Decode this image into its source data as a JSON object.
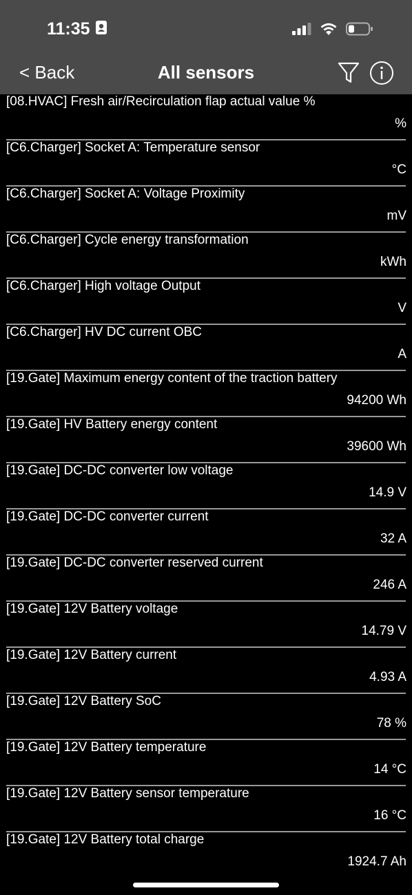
{
  "status_bar": {
    "time": "11:35",
    "icons": [
      "contact-card-icon",
      "signal-icon",
      "wifi-icon",
      "battery-icon"
    ]
  },
  "nav": {
    "back_label": "< Back",
    "title": "All sensors",
    "icons": [
      "filter-icon",
      "info-icon"
    ]
  },
  "sensors": [
    {
      "label": "[08.HVAC] Fresh air/Recirculation flap actual value %",
      "value": "%"
    },
    {
      "label": "[C6.Charger] Socket A: Temperature sensor",
      "value": "°C"
    },
    {
      "label": "[C6.Charger] Socket A: Voltage Proximity",
      "value": "mV"
    },
    {
      "label": "[C6.Charger] Cycle energy transformation",
      "value": "kWh"
    },
    {
      "label": "[C6.Charger] High voltage Output",
      "value": "V"
    },
    {
      "label": "[C6.Charger] HV DC current OBC",
      "value": "A"
    },
    {
      "label": "[19.Gate] Maximum energy content of the traction battery",
      "value": "94200 Wh"
    },
    {
      "label": "[19.Gate] HV Battery energy content",
      "value": "39600 Wh"
    },
    {
      "label": "[19.Gate] DC-DC converter low voltage",
      "value": "14.9 V"
    },
    {
      "label": "[19.Gate] DC-DC converter current",
      "value": "32 A"
    },
    {
      "label": "[19.Gate] DC-DC converter reserved current",
      "value": "246 A"
    },
    {
      "label": "[19.Gate] 12V Battery voltage",
      "value": "14.79 V"
    },
    {
      "label": "[19.Gate] 12V Battery current",
      "value": "4.93 A"
    },
    {
      "label": "[19.Gate] 12V Battery SoC",
      "value": "78 %"
    },
    {
      "label": "[19.Gate] 12V Battery temperature",
      "value": "14 °C"
    },
    {
      "label": "[19.Gate] 12V Battery sensor temperature",
      "value": "16 °C"
    },
    {
      "label": "[19.Gate] 12V Battery total charge",
      "value": "1924.7 Ah"
    }
  ]
}
